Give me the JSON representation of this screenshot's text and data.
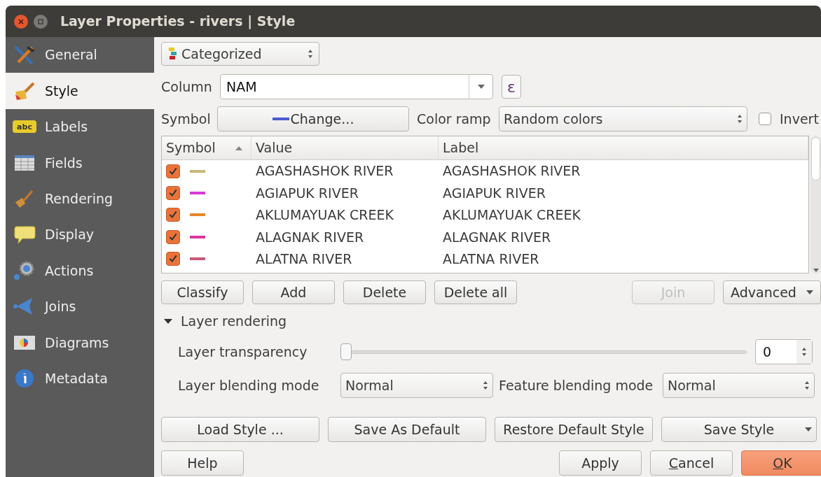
{
  "window": {
    "title": "Layer Properties - rivers | Style"
  },
  "sidebar": {
    "items": [
      {
        "label": "General",
        "selected": false,
        "kind": "tools"
      },
      {
        "label": "Style",
        "selected": true,
        "kind": "brush"
      },
      {
        "label": "Labels",
        "selected": false,
        "kind": "abc"
      },
      {
        "label": "Fields",
        "selected": false,
        "kind": "table"
      },
      {
        "label": "Rendering",
        "selected": false,
        "kind": "broom"
      },
      {
        "label": "Display",
        "selected": false,
        "kind": "bubble"
      },
      {
        "label": "Actions",
        "selected": false,
        "kind": "gear"
      },
      {
        "label": "Joins",
        "selected": false,
        "kind": "join"
      },
      {
        "label": "Diagrams",
        "selected": false,
        "kind": "chart"
      },
      {
        "label": "Metadata",
        "selected": false,
        "kind": "info"
      }
    ],
    "abc_badge": "abc"
  },
  "renderer": {
    "value": "Categorized"
  },
  "column": {
    "label": "Column",
    "value": "NAM",
    "expression_button": "ε"
  },
  "symbol": {
    "label": "Symbol",
    "button": "Change...",
    "color": "#4a5bcf"
  },
  "color_ramp": {
    "label": "Color ramp",
    "value": "Random colors"
  },
  "invert": {
    "label": "Invert",
    "checked": false
  },
  "table": {
    "columns": [
      "Symbol",
      "Value",
      "Label"
    ],
    "rows": [
      {
        "checked": true,
        "color": "#c8b878",
        "value": "AGASHASHOK RIVER",
        "label": "AGASHASHOK RIVER"
      },
      {
        "checked": true,
        "color": "#d63ad6",
        "value": "AGIAPUK RIVER",
        "label": "AGIAPUK RIVER"
      },
      {
        "checked": true,
        "color": "#e8872b",
        "value": "AKLUMAYUAK CREEK",
        "label": "AKLUMAYUAK CREEK"
      },
      {
        "checked": true,
        "color": "#d8389e",
        "value": "ALAGNAK RIVER",
        "label": "ALAGNAK RIVER"
      },
      {
        "checked": true,
        "color": "#c85a78",
        "value": "ALATNA RIVER",
        "label": "ALATNA RIVER"
      }
    ]
  },
  "class_buttons": [
    {
      "label": "Classify",
      "disabled": false
    },
    {
      "label": "Add",
      "disabled": false
    },
    {
      "label": "Delete",
      "disabled": false
    },
    {
      "label": "Delete all",
      "disabled": false
    }
  ],
  "join_button": {
    "label": "Join",
    "disabled": true
  },
  "advanced_button": {
    "label": "Advanced"
  },
  "layer_rendering": {
    "title": "Layer rendering",
    "expanded": true,
    "transparency": {
      "label": "Layer transparency",
      "level": 0,
      "value": "0"
    },
    "layer_blending": {
      "label": "Layer blending mode",
      "value": "Normal"
    },
    "feature_blending": {
      "label": "Feature blending mode",
      "value": "Normal"
    }
  },
  "style_buttons": [
    "Load Style ...",
    "Save As Default",
    "Restore Default Style"
  ],
  "save_style_button": "Save Style",
  "dialog_buttons": [
    {
      "label": "Help",
      "primary": false,
      "underline_first": false
    },
    {
      "label": "Apply",
      "primary": false,
      "underline_first": false
    },
    {
      "label": "Cancel",
      "primary": false,
      "underline_first": true
    },
    {
      "label": "OK",
      "primary": true,
      "underline_first": true
    }
  ]
}
